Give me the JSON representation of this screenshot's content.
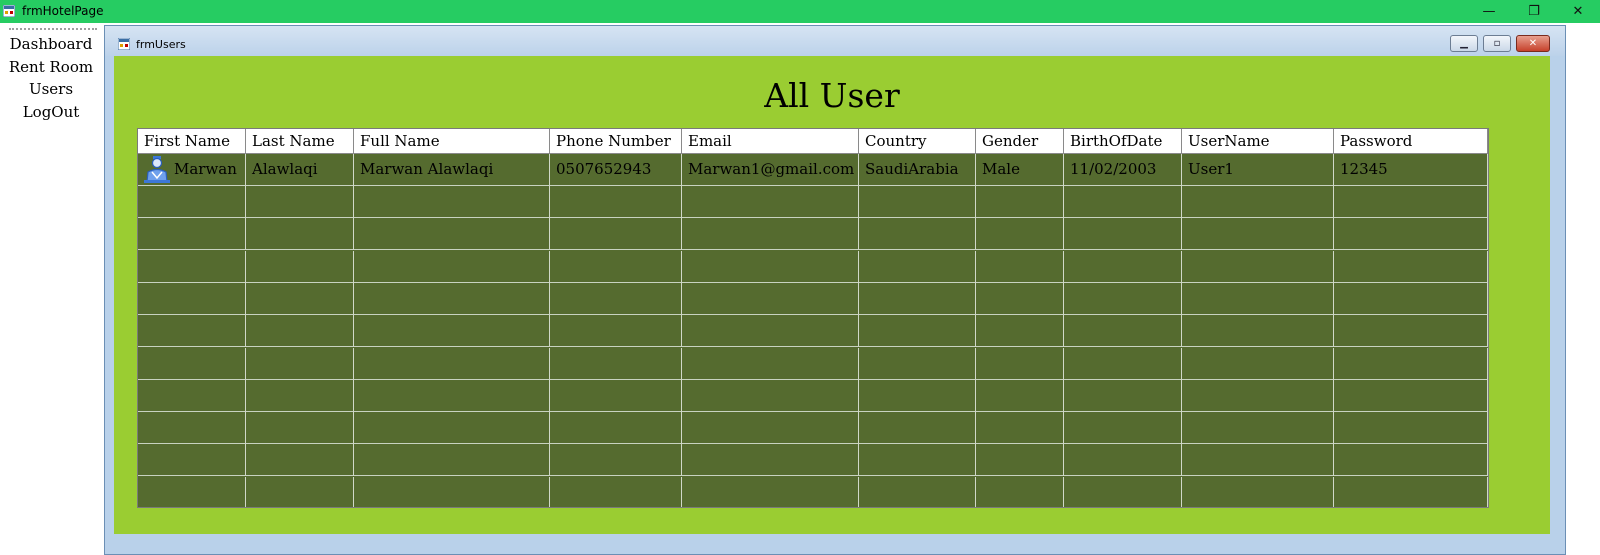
{
  "app": {
    "title": "frmHotelPage",
    "controls": {
      "minimize": "—",
      "restore": "❐",
      "close": "✕"
    }
  },
  "menu": {
    "items": [
      {
        "label": "Dashboard"
      },
      {
        "label": "Rent Room"
      },
      {
        "label": "Users"
      },
      {
        "label": "LogOut"
      }
    ]
  },
  "child_window": {
    "title": "frmUsers",
    "heading": "All User"
  },
  "grid": {
    "columns": [
      "First Name",
      "Last Name",
      "Full Name",
      "Phone Number",
      "Email",
      "Country",
      "Gender",
      "BirthOfDate",
      "UserName",
      "Password"
    ],
    "rows": [
      {
        "first_name": "Marwan",
        "last_name": "Alawlaqi",
        "full_name": "Marwan Alawlaqi",
        "phone": "0507652943",
        "email": "Marwan1@gmail.com",
        "country": "SaudiArabia",
        "gender": "Male",
        "birth": "11/02/2003",
        "username": "User1",
        "password": "12345",
        "icon": "user-icon"
      }
    ],
    "empty_rows": 10
  },
  "colors": {
    "app_titlebar": "#26cc62",
    "client_bg": "#9acd32",
    "grid_bg": "#556b2f"
  }
}
